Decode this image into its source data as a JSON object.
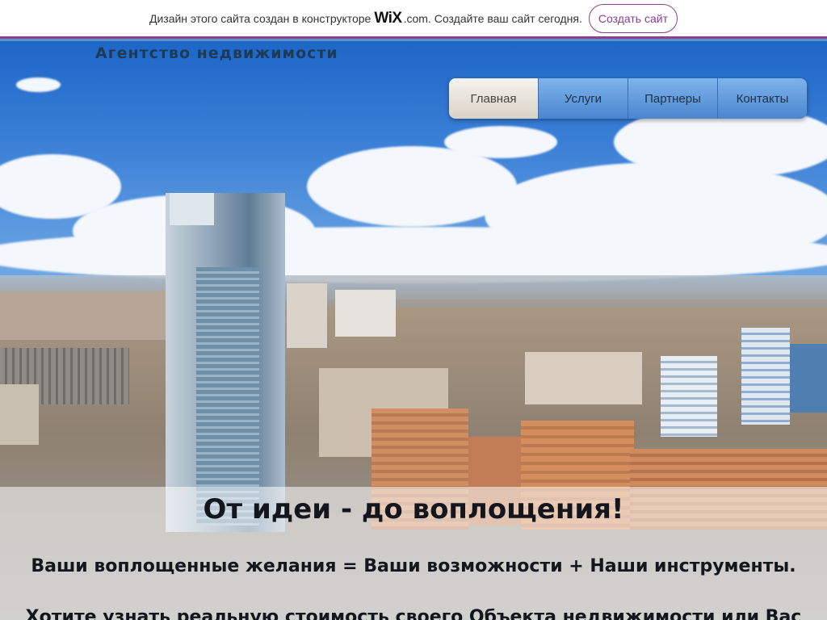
{
  "wix_banner": {
    "text_before": "Дизайн этого сайта создан в конструкторе",
    "logo": "WiX",
    "logo_suffix": ".com.",
    "text_after": "Создайте ваш сайт сегодня.",
    "button_label": "Создать сайт",
    "accent_color": "#8b3f8f"
  },
  "header": {
    "site_title": "Агентство недвижимости"
  },
  "nav": {
    "items": [
      {
        "label": "Главная",
        "active": true
      },
      {
        "label": "Услуги",
        "active": false
      },
      {
        "label": "Партнеры",
        "active": false
      },
      {
        "label": "Контакты",
        "active": false
      }
    ]
  },
  "hero": {
    "image": "city-aerial-photo",
    "headline": "От идеи - до воплощения!",
    "subline": "Ваши воплощенные желания = Ваши возможности + Наши инструменты.",
    "question": "Хотите узнать реальную стоимость своего Объекта недвижимости или Вас"
  }
}
